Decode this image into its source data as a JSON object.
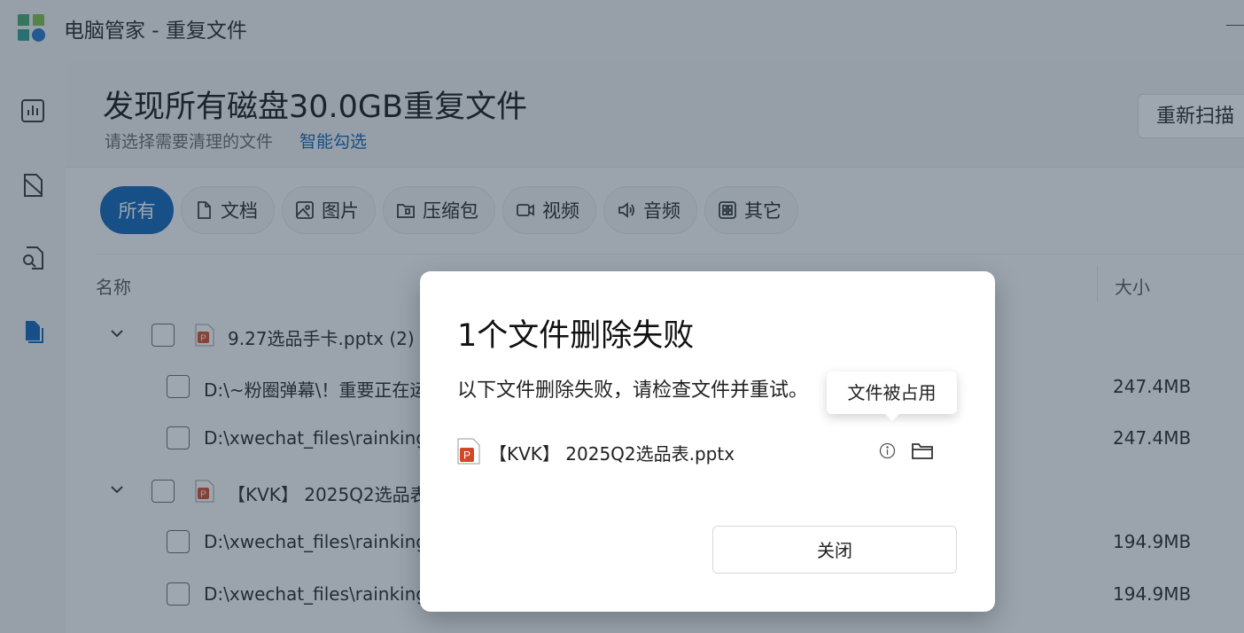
{
  "app": {
    "title": "电脑管家 - 重复文件"
  },
  "header": {
    "title": "发现所有磁盘30.0GB重复文件",
    "subtitle": "请选择需要清理的文件",
    "smart_select": "智能勾选",
    "rescan": "重新扫描"
  },
  "filters": [
    {
      "label": "所有",
      "icon": "all"
    },
    {
      "label": "文档",
      "icon": "document-icon"
    },
    {
      "label": "图片",
      "icon": "image-icon"
    },
    {
      "label": "压缩包",
      "icon": "archive-icon"
    },
    {
      "label": "视频",
      "icon": "video-icon"
    },
    {
      "label": "音频",
      "icon": "audio-icon"
    },
    {
      "label": "其它",
      "icon": "grid-icon"
    }
  ],
  "columns": {
    "name": "名称",
    "size": "大小"
  },
  "groups": [
    {
      "name": "9.27选品手卡.pptx (2)",
      "files": [
        {
          "path": "D:\\~粉圈弹幕\\！重要正在运",
          "size": "247.4MB"
        },
        {
          "path": "D:\\xwechat_files\\rainking",
          "size": "247.4MB"
        }
      ]
    },
    {
      "name": "【KVK】 2025Q2选品表",
      "files": [
        {
          "path": "D:\\xwechat_files\\rainking",
          "size": "194.9MB"
        },
        {
          "path": "D:\\xwechat_files\\rainking",
          "size": "194.9MB"
        }
      ]
    }
  ],
  "dialog": {
    "title": "1个文件删除失败",
    "message": "以下文件删除失败，请检查文件并重试。",
    "file_name": "【KVK】 2025Q2选品表.pptx",
    "tooltip": "文件被占用",
    "close": "关闭"
  },
  "colors": {
    "accent": "#0a5fb4",
    "ppt": "#d24726"
  }
}
